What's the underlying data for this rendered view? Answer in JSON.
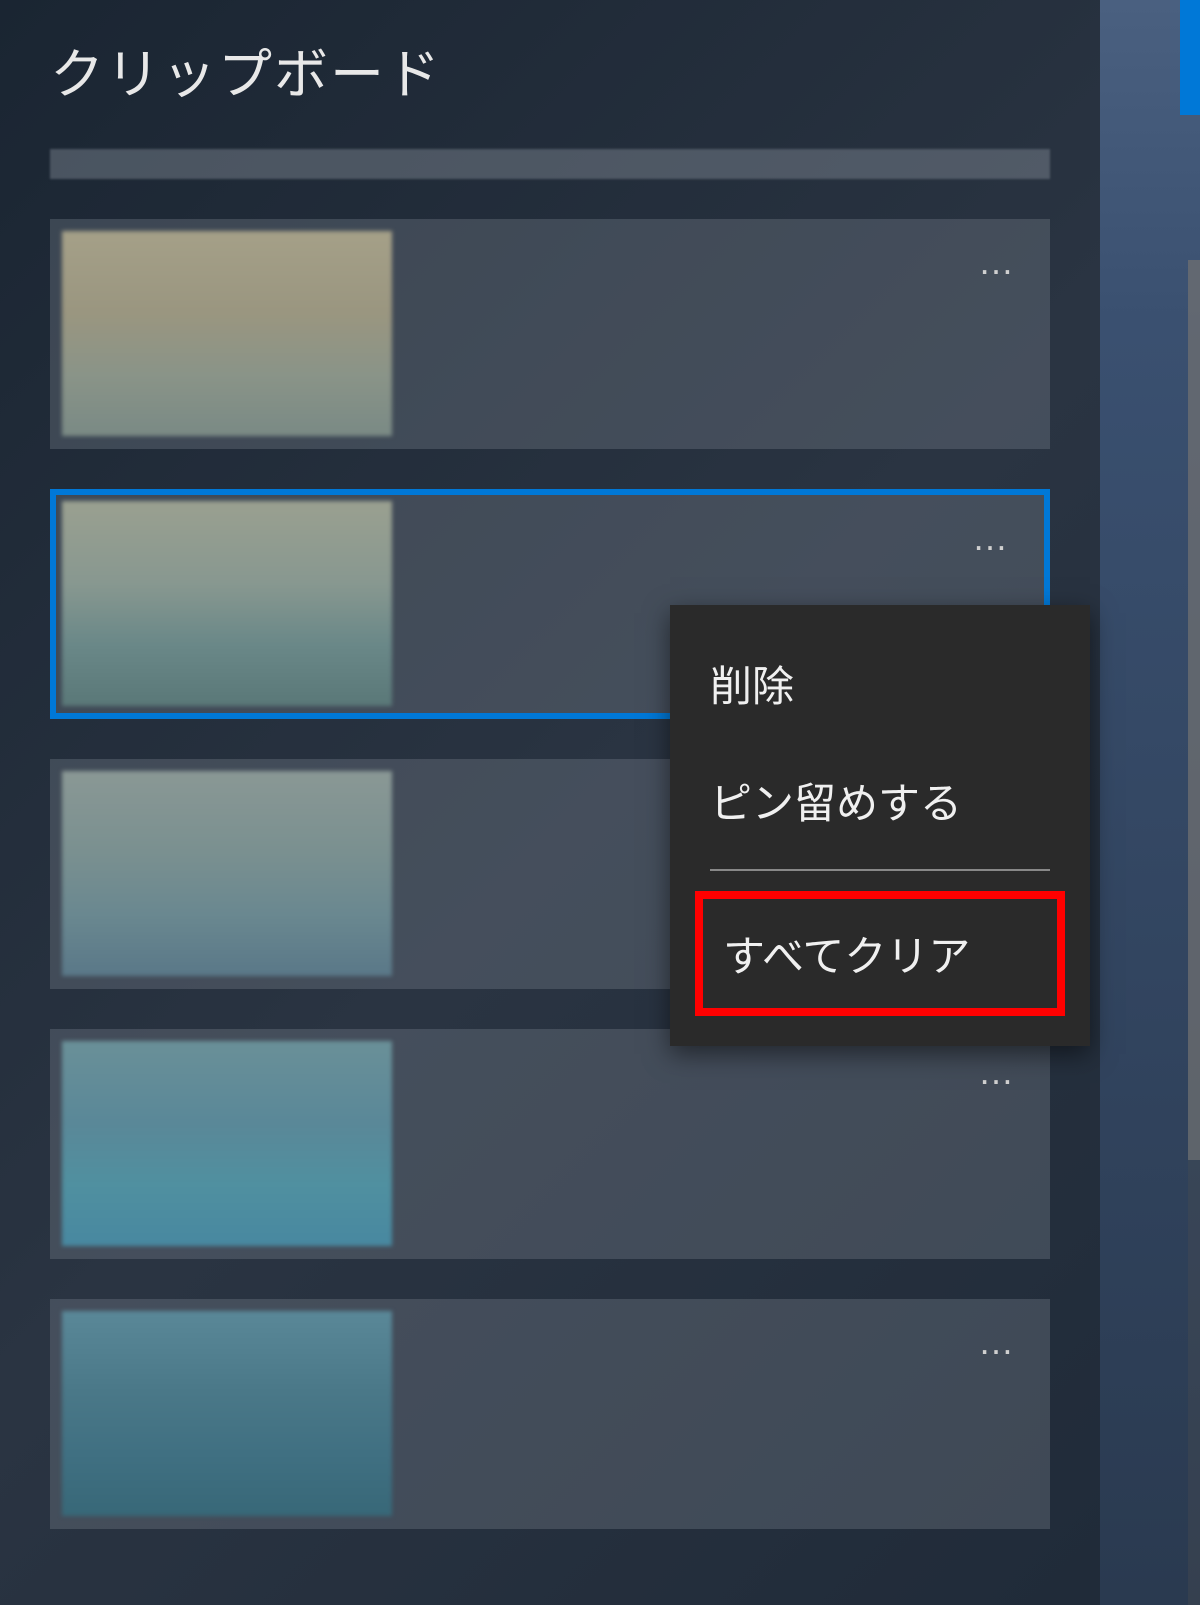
{
  "header": {
    "title": "クリップボード"
  },
  "items": [
    {
      "more_label": "…"
    },
    {
      "more_label": "…",
      "selected": true
    },
    {
      "more_label": "…"
    },
    {
      "more_label": "…"
    },
    {
      "more_label": "…"
    }
  ],
  "context_menu": {
    "delete": "削除",
    "pin": "ピン留めする",
    "clear_all": "すべてクリア"
  },
  "colors": {
    "selection_border": "#0078d7",
    "highlight_border": "#ff0000",
    "menu_bg": "#2a2a2a"
  }
}
